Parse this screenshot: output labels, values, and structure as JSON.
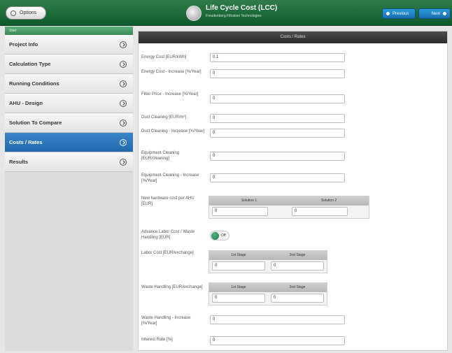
{
  "header": {
    "options_label": "Options",
    "title": "Life Cycle Cost (LCC)",
    "subtitle": "Freudenberg Filtration Technologies",
    "previous_label": "Previous",
    "next_label": "Next"
  },
  "sidebar": {
    "top_label": "Start",
    "items": [
      {
        "label": "Project Info"
      },
      {
        "label": "Calculation Type"
      },
      {
        "label": "Running Conditions"
      },
      {
        "label": "AHU - Design"
      },
      {
        "label": "Solution To Compare"
      },
      {
        "label": "Costs / Rates"
      },
      {
        "label": "Results"
      }
    ]
  },
  "main": {
    "panel_title": "Costs / Rates",
    "fields": {
      "energy_cost": {
        "label": "Energy Cost [EUR/kWh]",
        "value": "0.1"
      },
      "energy_increase": {
        "label": "Energy Cost - Increase [%/Year]",
        "value": "0"
      },
      "filter_price_increase": {
        "label": "Filter Price - Increase [%/Year]",
        "value": "0"
      },
      "duct_cleaning": {
        "label": "Duct Cleaning [EUR/m²]",
        "value": "0"
      },
      "duct_cleaning_increase": {
        "label": "Duct Cleaning - Increase [%/Year]",
        "value": "0"
      },
      "equipment_cleaning": {
        "label": "Equipment Cleaning [EUR/cleaning]",
        "value": "0"
      },
      "equipment_cleaning_increase": {
        "label": "Equipment Cleaning - Increase [%/Year]",
        "value": "0"
      },
      "hardware_cost": {
        "label": "New hardware cost per AHU [EUR]",
        "col1": "Solution 1",
        "col2": "Solution 2",
        "val1": "0",
        "val2": "0"
      },
      "advanced_labor": {
        "label": "Advance Labor Cost / Waste Handling [EUR]",
        "toggle_label": "Off"
      },
      "labor_cost": {
        "label": "Labor Cost [EUR/exchange]",
        "col1": "1st Stage",
        "col2": "2nd Stage",
        "val1": "0",
        "val2": "0"
      },
      "waste_handling": {
        "label": "Waste Handling [EUR/exchange]",
        "col1": "1st Stage",
        "col2": "2nd Stage",
        "val1": "0",
        "val2": "0"
      },
      "waste_increase": {
        "label": "Waste Handling - Increase [%/Year]",
        "value": "0"
      },
      "interest_rate": {
        "label": "Interest Rate [%]",
        "value": "0"
      }
    }
  }
}
